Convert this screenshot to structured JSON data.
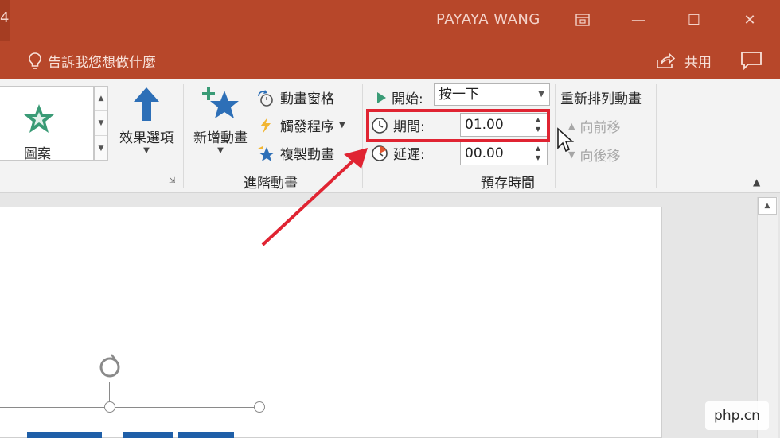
{
  "colors": {
    "titlebar": "#b7472a",
    "ribbon": "#f3f3f3",
    "highlight": "#e02432",
    "arrow": "#e02432",
    "accent_blue": "#1f5fa8",
    "star_green": "#3a9b76"
  },
  "titlebar": {
    "edge_glyph": "4",
    "user_name": "PAYAYA WANG",
    "restore_icon": "ribbon-display-icon",
    "minimize": "—",
    "maximize": "☐",
    "close": "✕"
  },
  "tellbar": {
    "tell_me": "告訴我您想做什麼",
    "share": "共用"
  },
  "ribbon": {
    "gallery_item": "圖案",
    "effect_options": "效果選項",
    "add_animation": "新增動畫",
    "animation_pane": "動畫窗格",
    "trigger": "觸發程序",
    "animation_painter": "複製動畫",
    "advanced_group": "進階動畫",
    "start_label": "開始:",
    "start_value": "按一下",
    "duration_label": "期間:",
    "duration_value": "01.00",
    "delay_label": "延遲:",
    "delay_value": "00.00",
    "timing_group": "預存時間",
    "reorder_title": "重新排列動畫",
    "move_earlier": "向前移",
    "move_later": "向後移"
  },
  "watermark": "php.cn"
}
